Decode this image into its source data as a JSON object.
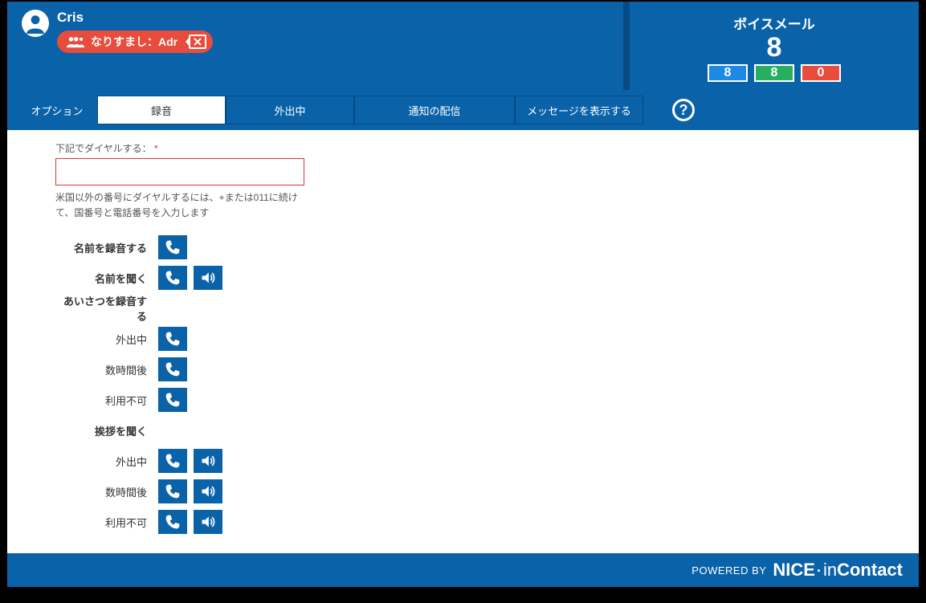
{
  "header": {
    "username": "Cris",
    "impersonate_prefix": "なりすまし：",
    "impersonate_user": "Adr"
  },
  "voicemail": {
    "title": "ボイスメール",
    "total": "8",
    "new_count": "8",
    "saved_count": "8",
    "deleted_count": "0"
  },
  "tabs": {
    "options": "オプション",
    "record": "録音",
    "away": "外出中",
    "delivery": "通知の配信",
    "show_messages": "メッセージを表示する"
  },
  "form": {
    "dial_label": "下記でダイヤルする：",
    "dial_hint": "米国以外の番号にダイヤルするには、+または011に続けて、国番号と電話番号を入力します",
    "record_name": "名前を録音する",
    "listen_name": "名前を聞く",
    "record_greeting": "あいさつを録音する",
    "away": "外出中",
    "hours_later": "数時間後",
    "unavailable": "利用不可",
    "listen_greeting": "挨拶を聞く"
  },
  "footer": {
    "powered_by": "POWERED BY",
    "brand_nice": "NICE",
    "brand_in": "in",
    "brand_contact": "Contact"
  }
}
